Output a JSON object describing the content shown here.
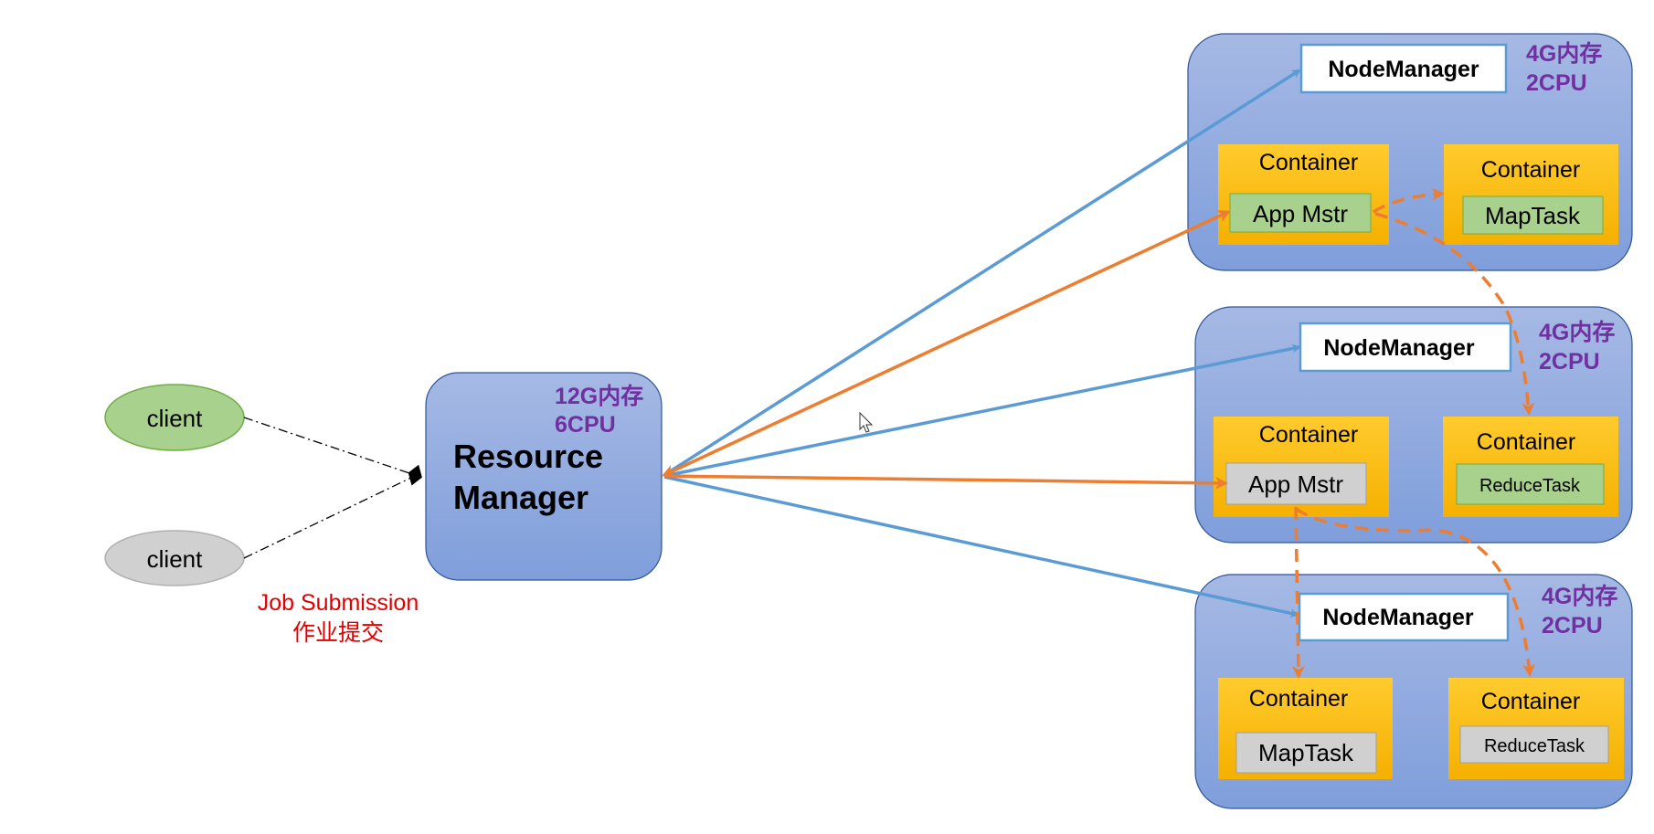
{
  "clients": [
    {
      "label": "client",
      "color": "#a9d18e"
    },
    {
      "label": "client",
      "color": "#d0d0d0"
    }
  ],
  "job_submission": {
    "en": "Job Submission",
    "zh": "作业提交",
    "color": "#e00000"
  },
  "resource_manager": {
    "line1": "Resource",
    "line2": "Manager",
    "mem": "12G内存",
    "cpu": "6CPU"
  },
  "nodes": [
    {
      "title": "NodeManager",
      "mem": "4G内存",
      "cpu": "2CPU",
      "containers": [
        {
          "label": "Container",
          "task": "App Mstr",
          "task_color": "#a9d18e"
        },
        {
          "label": "Container",
          "task": "MapTask",
          "task_color": "#a9d18e"
        }
      ]
    },
    {
      "title": "NodeManager",
      "mem": "4G内存",
      "cpu": "2CPU",
      "containers": [
        {
          "label": "Container",
          "task": "App Mstr",
          "task_color": "#d0d0d0"
        },
        {
          "label": "Container",
          "task": "ReduceTask",
          "task_color": "#a9d18e"
        }
      ]
    },
    {
      "title": "NodeManager",
      "mem": "4G内存",
      "cpu": "2CPU",
      "containers": [
        {
          "label": "Container",
          "task": "MapTask",
          "task_color": "#d0d0d0"
        },
        {
          "label": "Container",
          "task": "ReduceTask",
          "task_color": "#d0d0d0"
        }
      ]
    }
  ],
  "colors": {
    "blue_arrow": "#5b9bd5",
    "orange_arrow": "#ed7d31",
    "purple_text": "#7030a0",
    "container": "#ffc000"
  }
}
